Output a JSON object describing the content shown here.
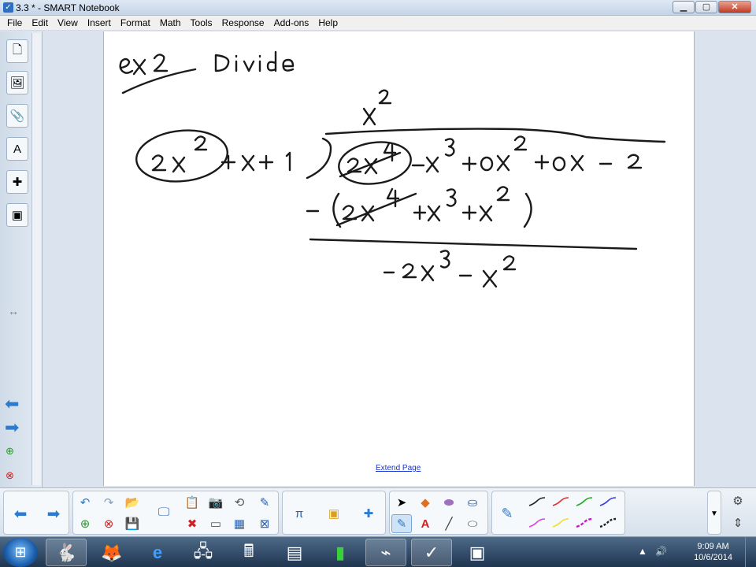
{
  "window": {
    "title": "3.3 * - SMART Notebook",
    "min": "▁",
    "max": "▢",
    "close": "✕"
  },
  "menu": [
    "File",
    "Edit",
    "View",
    "Insert",
    "Format",
    "Math",
    "Tools",
    "Response",
    "Add-ons",
    "Help"
  ],
  "canvas": {
    "extend_link": "Extend Page"
  },
  "taskbar": {
    "time": "9:09 AM",
    "date": "10/6/2014"
  },
  "colors": {
    "accent": "#2b7bd0",
    "pen_colors": [
      "#222222",
      "#e03030",
      "#22aa22",
      "#3a3ae0",
      "#e040e0",
      "#f0e020",
      "#c020c0",
      "#222222"
    ]
  },
  "icons": {
    "sidebar": [
      "page-sorter-icon",
      "gallery-icon",
      "attachments-icon",
      "properties-icon",
      "add-ons-icon",
      "response-icon"
    ],
    "toolbar": [
      "back-arrow-icon",
      "forward-arrow-icon",
      "undo-icon",
      "redo-icon",
      "open-file-icon",
      "add-page-icon",
      "delete-page-icon",
      "save-icon",
      "screen-shade-icon",
      "paste-icon",
      "delete-icon",
      "screen-capture-icon",
      "fill-icon",
      "table-icon",
      "magic-pen-icon",
      "math-icon",
      "response-icon",
      "add-ons-icon",
      "select-icon",
      "shapes-icon",
      "eraser-icon",
      "fill-bucket-icon",
      "pens-icon",
      "text-icon",
      "lines-icon",
      "creative-pen-icon"
    ]
  }
}
